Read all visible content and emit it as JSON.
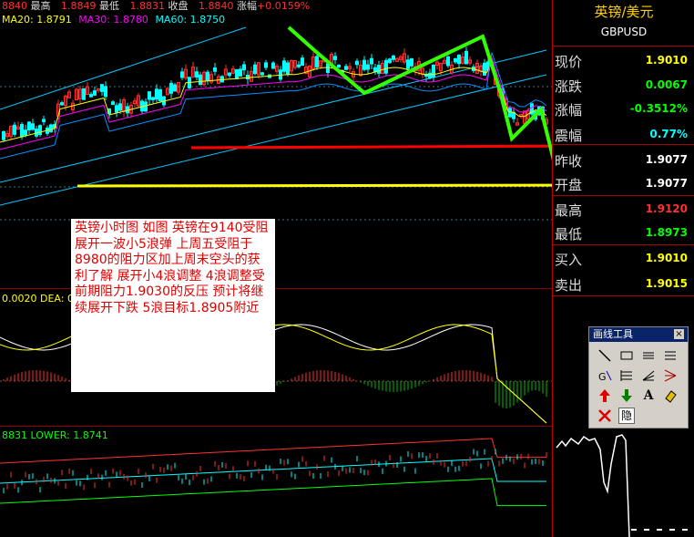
{
  "top_info": {
    "open_value": "8840",
    "high_label": "最高",
    "high_value": "1.8849",
    "low_label": "最低",
    "low_value": "1.8831",
    "close_label": "收盘",
    "close_value": "1.8840",
    "change_label": "涨幅",
    "change_value": "+0.0159%"
  },
  "ma_info": {
    "ma20": "MA20: 1.8791",
    "ma30": "MA30: 1.8780",
    "ma60": "MA60: 1.8750"
  },
  "macd_info": {
    "text": "0.0020 DEA: 0."
  },
  "boll_info": {
    "text": "8831 LOWER: 1.8741"
  },
  "note": {
    "text": "英镑小时图 如图 英镑在9140受阻 展开一波小5浪弹 上周五受阻于8980的阻力区加上周末空头的获利了解 展开小4浪调整 4浪调整受前期阻力1.9030的反压 预计将继续展开下跌 5浪目标1.8905附近"
  },
  "side_panel": {
    "symbol_name": "英镑/美元",
    "symbol_code": "GBPUSD",
    "rows": [
      {
        "label": "现价",
        "value": "1.9010",
        "color": "#ffff00"
      },
      {
        "label": "涨跌",
        "value": "0.0067",
        "color": "#00ff00"
      },
      {
        "label": "涨幅",
        "value": "-0.3512%",
        "color": "#00ff00"
      },
      {
        "label": "震幅",
        "value": "0.77%",
        "color": "#00ffff"
      },
      {
        "label": "昨收",
        "value": "1.9077",
        "color": "#ffffff"
      },
      {
        "label": "开盘",
        "value": "1.9077",
        "color": "#ffffff"
      },
      {
        "label": "最高",
        "value": "1.9120",
        "color": "#ff3030"
      },
      {
        "label": "最低",
        "value": "1.8973",
        "color": "#00ff00"
      },
      {
        "label": "买入",
        "value": "1.9010",
        "color": "#ffff00"
      },
      {
        "label": "卖出",
        "value": "1.9015",
        "color": "#ffff00"
      }
    ]
  },
  "draw_tools": {
    "title": "画线工具",
    "close": "×",
    "tools": [
      "line-tool",
      "rect-tool",
      "parallel-tool",
      "channel-tool",
      "gann-tool",
      "fib-tool",
      "speed-tool",
      "fan-tool",
      "up-arrow-tool",
      "down-arrow-tool",
      "text-tool",
      "erase-tool",
      "delete-tool",
      "hide-tool"
    ],
    "text_glyph": "A",
    "hide_glyph": "隐"
  },
  "colors": {
    "up": "#ff3030",
    "down": "#00ffff",
    "wave": "#33ff00",
    "support": "#ff0000",
    "target": "#ffff00",
    "ma20": "#ffff00",
    "ma30": "#ff00ff",
    "ma60": "#00a0ff"
  }
}
